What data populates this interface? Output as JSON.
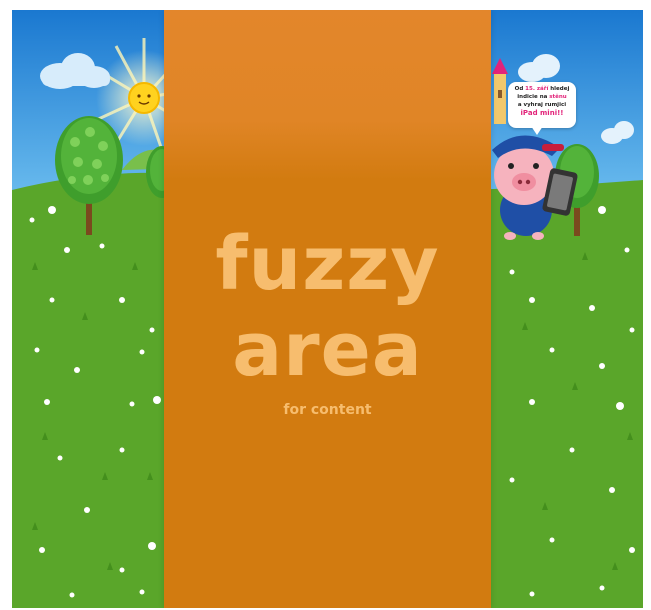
{
  "center": {
    "title_line1": "fuzzy",
    "title_line2": "area",
    "subtitle": "for content"
  },
  "promo_bubble": {
    "line1_a": "Od ",
    "line1_b": "15. září",
    "line1_c": " hledej",
    "line2_a": "indicie na ",
    "line2_b": "stěnu",
    "line3": "a vyhraj rumjici",
    "line4": "iPad mini!!"
  },
  "colors": {
    "sky_top": "#1a78d0",
    "sky_bottom": "#5fb7ee",
    "grass": "#5aa62a",
    "grass_dark": "#3f8a1a",
    "panel": "#d27b10",
    "title": "#f7bd6e",
    "accent_pink": "#e2247a"
  },
  "icons": [
    "sun-icon",
    "cloud-icon",
    "tree-icon",
    "castle-icon",
    "pig-mascot-icon",
    "tablet-icon",
    "daisy-icon"
  ]
}
